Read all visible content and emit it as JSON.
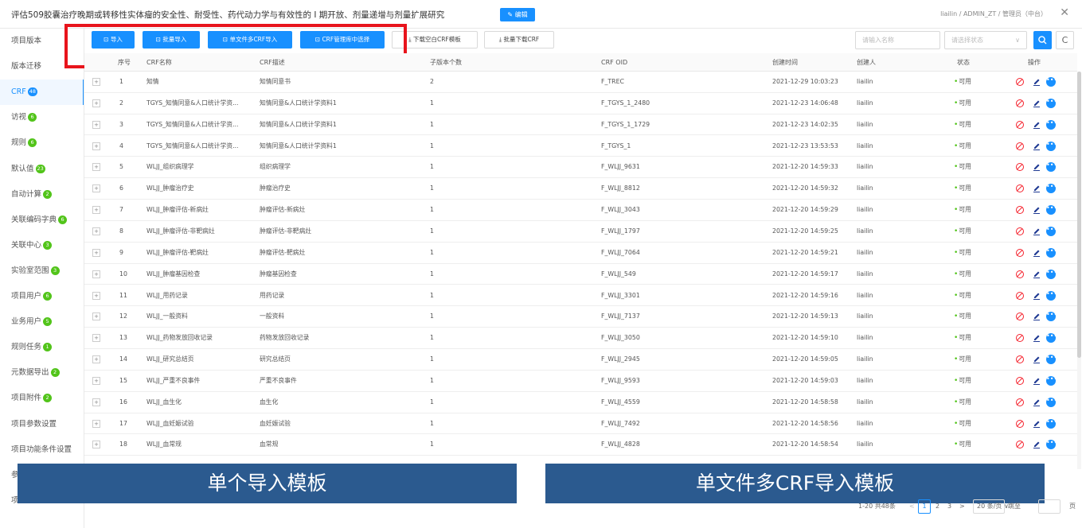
{
  "header": {
    "project_title": "评估509胶囊治疗晚期或转移性实体瘤的安全性、耐受性、药代动力学与有效性的 I 期开放、剂量递增与剂量扩展研究",
    "edit_label": "✎ 编辑",
    "user_info": "liailin / ADMIN_ZT / 管理员（中台）",
    "close_label": "✕"
  },
  "sidebar": {
    "items": [
      {
        "label": "项目版本",
        "badge": ""
      },
      {
        "label": "版本迁移",
        "badge": ""
      },
      {
        "label": "CRF",
        "badge": "48"
      },
      {
        "label": "访视",
        "badge": "6"
      },
      {
        "label": "规则",
        "badge": "6"
      },
      {
        "label": "默认值",
        "badge": "23"
      },
      {
        "label": "自动计算",
        "badge": "2"
      },
      {
        "label": "关联编码字典",
        "badge": "6"
      },
      {
        "label": "关联中心",
        "badge": "3"
      },
      {
        "label": "实验室范围",
        "badge": "3"
      },
      {
        "label": "项目用户",
        "badge": "6"
      },
      {
        "label": "业务用户",
        "badge": "5"
      },
      {
        "label": "规则任务",
        "badge": "1"
      },
      {
        "label": "元数据导出",
        "badge": "2"
      },
      {
        "label": "项目附件",
        "badge": "2"
      },
      {
        "label": "项目参数设置",
        "badge": ""
      },
      {
        "label": "项目功能条件设置",
        "badge": ""
      },
      {
        "label": "参",
        "badge": ""
      },
      {
        "label": "项",
        "badge": ""
      }
    ]
  },
  "toolbar": {
    "import": "⊡ 导入",
    "batch_import": "⊡ 批量导入",
    "multi_crf_import": "⊡ 单文件多CRF导入",
    "crf_library_select": "⊡ CRF管理库中选择",
    "download_template": "⤓ 下载空白CRF模板",
    "batch_download": "⤓ 批量下载CRF",
    "search_placeholder": "请输入名称",
    "status_placeholder": "请选择状态",
    "refresh_label": "C"
  },
  "table": {
    "columns": [
      "序号",
      "CRF名称",
      "CRF描述",
      "子版本个数",
      "CRF OID",
      "创建时间",
      "创建人",
      "状态",
      "操作"
    ],
    "rows": [
      {
        "no": "1",
        "name": "知情",
        "desc": "知情同意书",
        "subs": "2",
        "oid": "F_TREC",
        "time": "2021-12-29 10:03:23",
        "creator": "liailin",
        "status": "可用"
      },
      {
        "no": "2",
        "name": "TGYS_知情同意&人口统计学资...",
        "desc": "知情同意&人口统计学资料1",
        "subs": "1",
        "oid": "F_TGYS_1_2480",
        "time": "2021-12-23 14:06:48",
        "creator": "liailin",
        "status": "可用"
      },
      {
        "no": "3",
        "name": "TGYS_知情同意&人口统计学资...",
        "desc": "知情同意&人口统计学资料1",
        "subs": "1",
        "oid": "F_TGYS_1_1729",
        "time": "2021-12-23 14:02:35",
        "creator": "liailin",
        "status": "可用"
      },
      {
        "no": "4",
        "name": "TGYS_知情同意&人口统计学资...",
        "desc": "知情同意&人口统计学资料1",
        "subs": "1",
        "oid": "F_TGYS_1",
        "time": "2021-12-23 13:53:53",
        "creator": "liailin",
        "status": "可用"
      },
      {
        "no": "5",
        "name": "WLJJ_组织病理学",
        "desc": "组织病理学",
        "subs": "1",
        "oid": "F_WLJJ_9631",
        "time": "2021-12-20 14:59:33",
        "creator": "liailin",
        "status": "可用"
      },
      {
        "no": "6",
        "name": "WLJJ_肿瘤治疗史",
        "desc": "肿瘤治疗史",
        "subs": "1",
        "oid": "F_WLJJ_8812",
        "time": "2021-12-20 14:59:32",
        "creator": "liailin",
        "status": "可用"
      },
      {
        "no": "7",
        "name": "WLJJ_肿瘤评估-新病灶",
        "desc": "肿瘤评估-新病灶",
        "subs": "1",
        "oid": "F_WLJJ_3043",
        "time": "2021-12-20 14:59:29",
        "creator": "liailin",
        "status": "可用"
      },
      {
        "no": "8",
        "name": "WLJJ_肿瘤评估-非靶病灶",
        "desc": "肿瘤评估-非靶病灶",
        "subs": "1",
        "oid": "F_WLJJ_1797",
        "time": "2021-12-20 14:59:25",
        "creator": "liailin",
        "status": "可用"
      },
      {
        "no": "9",
        "name": "WLJJ_肿瘤评估-靶病灶",
        "desc": "肿瘤评估-靶病灶",
        "subs": "1",
        "oid": "F_WLJJ_7064",
        "time": "2021-12-20 14:59:21",
        "creator": "liailin",
        "status": "可用"
      },
      {
        "no": "10",
        "name": "WLJJ_肿瘤基因检查",
        "desc": "肿瘤基因检查",
        "subs": "1",
        "oid": "F_WLJJ_549",
        "time": "2021-12-20 14:59:17",
        "creator": "liailin",
        "status": "可用"
      },
      {
        "no": "11",
        "name": "WLJJ_用药记录",
        "desc": "用药记录",
        "subs": "1",
        "oid": "F_WLJJ_3301",
        "time": "2021-12-20 14:59:16",
        "creator": "liailin",
        "status": "可用"
      },
      {
        "no": "12",
        "name": "WLJJ_一般资料",
        "desc": "一般资料",
        "subs": "1",
        "oid": "F_WLJJ_7137",
        "time": "2021-12-20 14:59:13",
        "creator": "liailin",
        "status": "可用"
      },
      {
        "no": "13",
        "name": "WLJJ_药物发放回收记录",
        "desc": "药物发放回收记录",
        "subs": "1",
        "oid": "F_WLJJ_3050",
        "time": "2021-12-20 14:59:10",
        "creator": "liailin",
        "status": "可用"
      },
      {
        "no": "14",
        "name": "WLJJ_研究总结页",
        "desc": "研究总结页",
        "subs": "1",
        "oid": "F_WLJJ_2945",
        "time": "2021-12-20 14:59:05",
        "creator": "liailin",
        "status": "可用"
      },
      {
        "no": "15",
        "name": "WLJJ_严重不良事件",
        "desc": "严重不良事件",
        "subs": "1",
        "oid": "F_WLJJ_9593",
        "time": "2021-12-20 14:59:03",
        "creator": "liailin",
        "status": "可用"
      },
      {
        "no": "16",
        "name": "WLJJ_血生化",
        "desc": "血生化",
        "subs": "1",
        "oid": "F_WLJJ_4559",
        "time": "2021-12-20 14:58:58",
        "creator": "liailin",
        "status": "可用"
      },
      {
        "no": "17",
        "name": "WLJJ_血妊娠试验",
        "desc": "血妊娠试验",
        "subs": "1",
        "oid": "F_WLJJ_7492",
        "time": "2021-12-20 14:58:56",
        "creator": "liailin",
        "status": "可用"
      },
      {
        "no": "18",
        "name": "WLJJ_血常规",
        "desc": "血常规",
        "subs": "1",
        "oid": "F_WLJJ_4828",
        "time": "2021-12-20 14:58:54",
        "creator": "liailin",
        "status": "可用"
      }
    ]
  },
  "banners": {
    "left": "单个导入模板",
    "right": "单文件多CRF导入模板"
  },
  "pagination": {
    "summary": "1-20 共48条",
    "prev": "<",
    "pages": [
      "1",
      "2",
      "3"
    ],
    "next": ">",
    "page_size": "20 条/页 ∨",
    "jump_label": "跳至",
    "page_unit": "页"
  },
  "colors": {
    "accent": "#1890ff",
    "danger": "#f5222d",
    "success": "#52c41a",
    "banner": "#2b5a8f",
    "highlight_box": "#e8141c"
  }
}
